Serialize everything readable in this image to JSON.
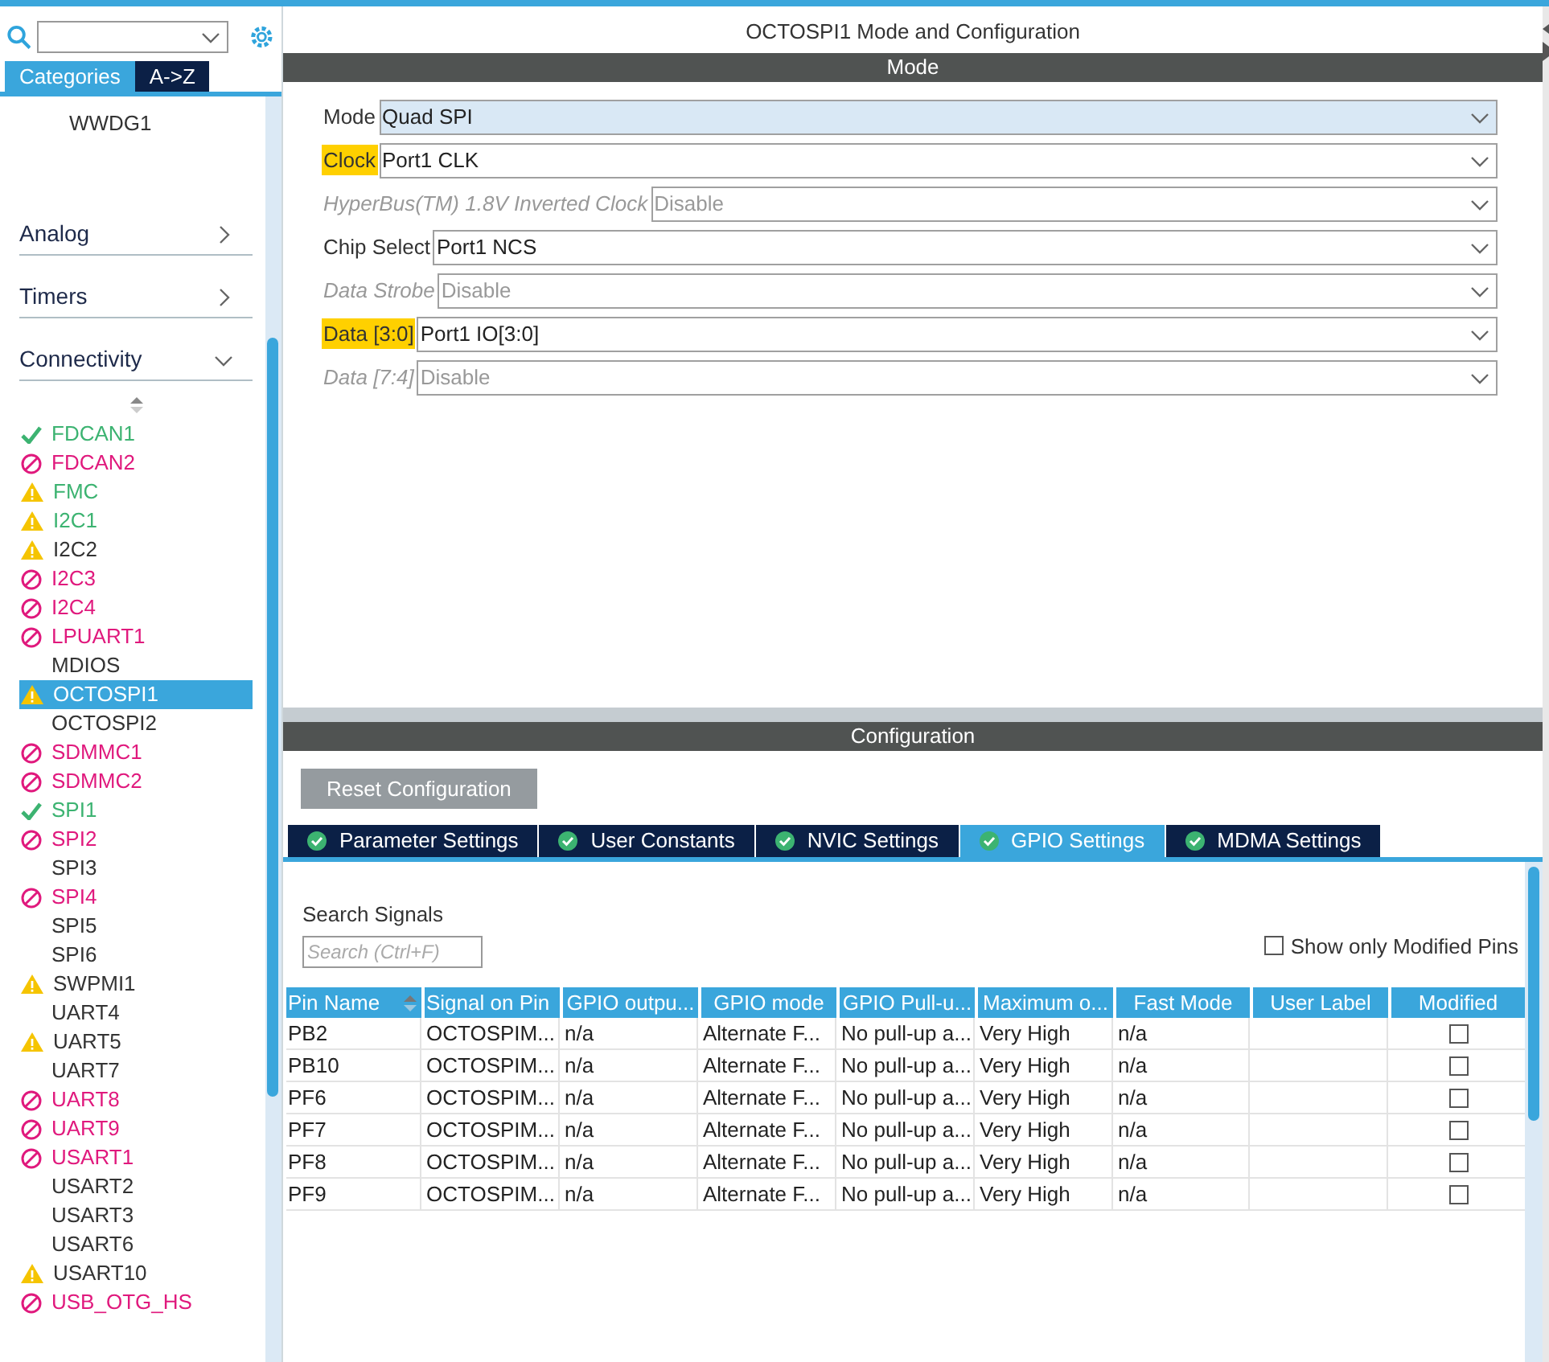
{
  "sidebar": {
    "tabs": [
      {
        "label": "Categories",
        "selected": true
      },
      {
        "label": "A->Z",
        "selected": false
      }
    ],
    "top_items": [
      {
        "name": "WWDG1"
      }
    ],
    "categories": [
      {
        "label": "Analog",
        "expanded": false
      },
      {
        "label": "Timers",
        "expanded": false
      },
      {
        "label": "Connectivity",
        "expanded": true
      }
    ],
    "items": [
      {
        "name": "FDCAN1",
        "kind": "ok",
        "color": "#3cb371",
        "selected": false
      },
      {
        "name": "FDCAN2",
        "kind": "blocked",
        "color": "#e0197d",
        "selected": false
      },
      {
        "name": "FMC",
        "kind": "warn",
        "color": "#3cb371",
        "selected": false
      },
      {
        "name": "I2C1",
        "kind": "warn",
        "color": "#3cb371",
        "selected": false
      },
      {
        "name": "I2C2",
        "kind": "warn",
        "color": "#333333",
        "selected": false
      },
      {
        "name": "I2C3",
        "kind": "blocked",
        "color": "#e0197d",
        "selected": false
      },
      {
        "name": "I2C4",
        "kind": "blocked",
        "color": "#e0197d",
        "selected": false
      },
      {
        "name": "LPUART1",
        "kind": "blocked",
        "color": "#e0197d",
        "selected": false
      },
      {
        "name": "MDIOS",
        "kind": "none",
        "color": "#333333",
        "selected": false
      },
      {
        "name": "OCTOSPI1",
        "kind": "warn",
        "selected": true
      },
      {
        "name": "OCTOSPI2",
        "kind": "none",
        "color": "#333333",
        "selected": false
      },
      {
        "name": "SDMMC1",
        "kind": "blocked",
        "color": "#e0197d",
        "selected": false
      },
      {
        "name": "SDMMC2",
        "kind": "blocked",
        "color": "#e0197d",
        "selected": false
      },
      {
        "name": "SPI1",
        "kind": "ok",
        "color": "#3cb371",
        "selected": false
      },
      {
        "name": "SPI2",
        "kind": "blocked",
        "color": "#e0197d",
        "selected": false
      },
      {
        "name": "SPI3",
        "kind": "none",
        "color": "#333333",
        "selected": false
      },
      {
        "name": "SPI4",
        "kind": "blocked",
        "color": "#e0197d",
        "selected": false
      },
      {
        "name": "SPI5",
        "kind": "none",
        "color": "#333333",
        "selected": false
      },
      {
        "name": "SPI6",
        "kind": "none",
        "color": "#333333",
        "selected": false
      },
      {
        "name": "SWPMI1",
        "kind": "warn",
        "color": "#333333",
        "selected": false
      },
      {
        "name": "UART4",
        "kind": "none",
        "color": "#333333",
        "selected": false
      },
      {
        "name": "UART5",
        "kind": "warn",
        "color": "#333333",
        "selected": false
      },
      {
        "name": "UART7",
        "kind": "none",
        "color": "#333333",
        "selected": false
      },
      {
        "name": "UART8",
        "kind": "blocked",
        "color": "#e0197d",
        "selected": false
      },
      {
        "name": "UART9",
        "kind": "blocked",
        "color": "#e0197d",
        "selected": false
      },
      {
        "name": "USART1",
        "kind": "blocked",
        "color": "#e0197d",
        "selected": false
      },
      {
        "name": "USART2",
        "kind": "none",
        "color": "#333333",
        "selected": false
      },
      {
        "name": "USART3",
        "kind": "none",
        "color": "#333333",
        "selected": false
      },
      {
        "name": "USART6",
        "kind": "none",
        "color": "#333333",
        "selected": false
      },
      {
        "name": "USART10",
        "kind": "warn",
        "color": "#333333",
        "selected": false
      },
      {
        "name": "USB_OTG_HS",
        "kind": "blocked",
        "color": "#e0197d",
        "selected": false
      }
    ]
  },
  "title": "OCTOSPI1 Mode and Configuration",
  "mode": {
    "header": "Mode",
    "fields": [
      {
        "label": "Mode",
        "value": "Quad SPI",
        "disabled": false,
        "highlighted": false,
        "focused": true
      },
      {
        "label": "Clock",
        "value": "Port1 CLK",
        "disabled": false,
        "highlighted": true,
        "focused": false
      },
      {
        "label": "HyperBus(TM) 1.8V Inverted Clock",
        "value": "Disable",
        "disabled": true,
        "highlighted": false,
        "focused": false
      },
      {
        "label": "Chip Select",
        "value": "Port1 NCS",
        "disabled": false,
        "highlighted": false,
        "focused": false
      },
      {
        "label": "Data Strobe",
        "value": "Disable",
        "disabled": true,
        "highlighted": false,
        "focused": false
      },
      {
        "label": "Data [3:0]",
        "value": "Port1 IO[3:0]",
        "disabled": false,
        "highlighted": true,
        "focused": false
      },
      {
        "label": "Data [7:4]",
        "value": "Disable",
        "disabled": true,
        "highlighted": false,
        "focused": false
      }
    ]
  },
  "configuration": {
    "header": "Configuration",
    "reset_button": "Reset Configuration",
    "tabs": [
      {
        "label": "Parameter Settings",
        "selected": false
      },
      {
        "label": "User Constants",
        "selected": false
      },
      {
        "label": "NVIC Settings",
        "selected": false
      },
      {
        "label": "GPIO Settings",
        "selected": true
      },
      {
        "label": "MDMA Settings",
        "selected": false
      }
    ],
    "search_label": "Search Signals",
    "search": {
      "placeholder": "Search (Ctrl+F)"
    },
    "show_modified": {
      "label": "Show only Modified Pins",
      "checked": false
    },
    "table": {
      "columns": [
        "Pin Name",
        "Signal on Pin",
        "GPIO outpu...",
        "GPIO mode",
        "GPIO Pull-u...",
        "Maximum o...",
        "Fast Mode",
        "User Label",
        "Modified"
      ],
      "rows": [
        {
          "cells": [
            "PB2",
            "OCTOSPIM...",
            "n/a",
            "Alternate F...",
            "No pull-up a...",
            "Very High",
            "n/a"
          ],
          "modified": false
        },
        {
          "cells": [
            "PB10",
            "OCTOSPIM...",
            "n/a",
            "Alternate F...",
            "No pull-up a...",
            "Very High",
            "n/a"
          ],
          "modified": false
        },
        {
          "cells": [
            "PF6",
            "OCTOSPIM...",
            "n/a",
            "Alternate F...",
            "No pull-up a...",
            "Very High",
            "n/a"
          ],
          "modified": false
        },
        {
          "cells": [
            "PF7",
            "OCTOSPIM...",
            "n/a",
            "Alternate F...",
            "No pull-up a...",
            "Very High",
            "n/a"
          ],
          "modified": false
        },
        {
          "cells": [
            "PF8",
            "OCTOSPIM...",
            "n/a",
            "Alternate F...",
            "No pull-up a...",
            "Very High",
            "n/a"
          ],
          "modified": false
        },
        {
          "cells": [
            "PF9",
            "OCTOSPIM...",
            "n/a",
            "Alternate F...",
            "No pull-up a...",
            "Very High",
            "n/a"
          ],
          "modified": false
        }
      ]
    }
  }
}
